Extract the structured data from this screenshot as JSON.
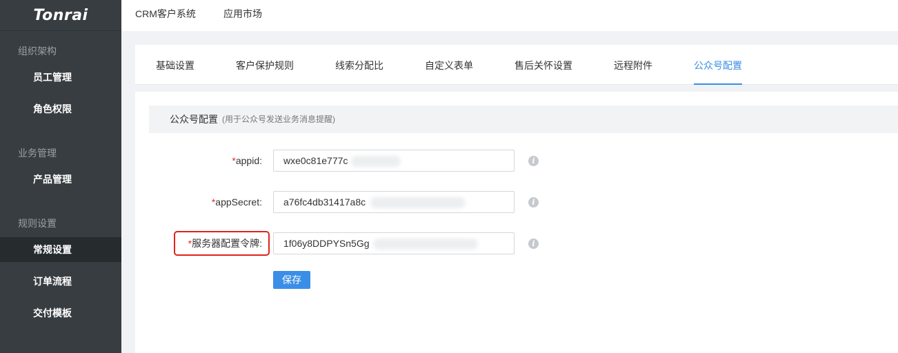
{
  "app": {
    "logo": "Tonrai"
  },
  "sidebar": {
    "groups": [
      {
        "title": "组织架构",
        "items": [
          "员工管理",
          "角色权限"
        ]
      },
      {
        "title": "业务管理",
        "items": [
          "产品管理"
        ]
      },
      {
        "title": "规则设置",
        "items": [
          "常规设置",
          "订单流程",
          "交付模板"
        ]
      }
    ],
    "active_item": "常规设置"
  },
  "topbar": {
    "nav": [
      "CRM客户系统",
      "应用市场"
    ]
  },
  "tabs": {
    "items": [
      "基础设置",
      "客户保护规则",
      "线索分配比",
      "自定义表单",
      "售后关怀设置",
      "远程附件",
      "公众号配置"
    ],
    "active": "公众号配置"
  },
  "section": {
    "title": "公众号配置",
    "subtitle": "(用于公众号发送业务消息提醒)"
  },
  "form": {
    "fields": [
      {
        "required": "*",
        "label": "appid:",
        "value": "wxe0c81e777c"
      },
      {
        "required": "*",
        "label": "appSecret:",
        "value": "a76fc4db31417a8c"
      },
      {
        "required": "*",
        "label": "服务器配置令牌:",
        "value": "1f06y8DDPYSn5Gg"
      }
    ],
    "info_icon": "i",
    "save_label": "保存"
  },
  "colors": {
    "sidebar_bg": "#373d41",
    "accent": "#3a8ee6",
    "required": "#e02b2b",
    "highlight": "#e0221a"
  }
}
